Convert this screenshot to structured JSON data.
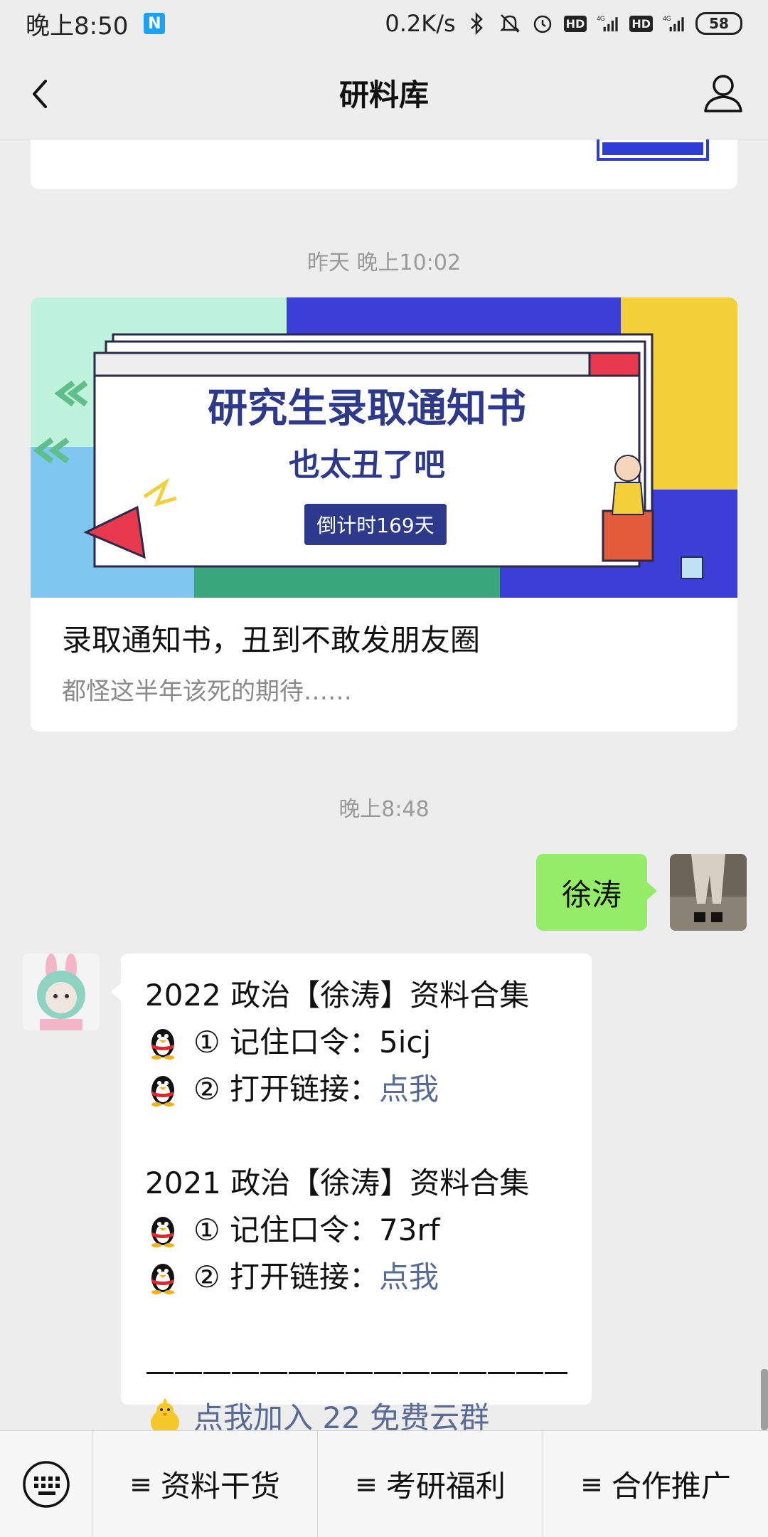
{
  "status_bar": {
    "time": "晚上8:50",
    "net_speed": "0.2K/s",
    "battery": "58",
    "sig1_label": "4G",
    "sig2_label": "4G",
    "hd1": "HD",
    "hd2": "HD"
  },
  "nav": {
    "title": "研料库"
  },
  "chat": {
    "timestamp_1": "昨天 晚上10:02",
    "article": {
      "banner_title": "研究生录取通知书",
      "banner_subtitle": "也太丑了吧",
      "banner_badge": "倒计时169天",
      "title": "录取通知书，丑到不敢发朋友圈",
      "desc": "都怪这半年该死的期待……"
    },
    "timestamp_2": "晚上8:48",
    "my_message": "徐涛",
    "reply": {
      "line1": "2022 政治【徐涛】资料合集",
      "line2_prefix": "① 记住口令：",
      "line2_code": "5icj",
      "line3_prefix": "② 打开链接：",
      "line3_link": "点我",
      "line5": "2021 政治【徐涛】资料合集",
      "line6_prefix": "① 记住口令：",
      "line6_code": "73rf",
      "line7_prefix": "② 打开链接：",
      "line7_link": "点我",
      "divider": "————————————————————————————",
      "join_link": "点我加入 22 免费云群"
    }
  },
  "bottom_menu": {
    "items": [
      {
        "label": "资料干货"
      },
      {
        "label": "考研福利"
      },
      {
        "label": "合作推广"
      }
    ],
    "item_glyph": "≡"
  },
  "colors": {
    "bg": "#ededed",
    "my_bubble": "#95ec69",
    "link": "#576b95"
  },
  "icons": [
    "back-arrow-icon",
    "profile-icon",
    "keyboard-icon",
    "penguin-icon",
    "chick-icon",
    "bluetooth-icon",
    "mute-icon",
    "alarm-icon"
  ]
}
